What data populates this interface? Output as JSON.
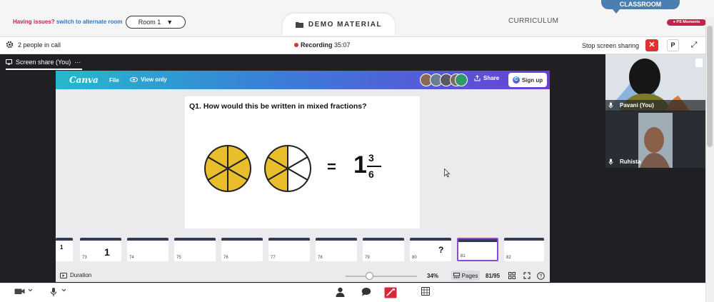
{
  "top": {
    "issues_text": "Having issues?",
    "issues_link": "switch to alternate room",
    "room_label": "Room 1",
    "room_caret": "▼",
    "tab_demo": "DEMO MATERIAL",
    "tab_curriculum": "CURRICULUM",
    "classroom_label": "CLASSROOM",
    "ps_moments": "PS Moments"
  },
  "call": {
    "people": "2 people in call",
    "recording_label": "Recording",
    "recording_time": "35:07",
    "stop_share": "Stop screen sharing",
    "close": "✕",
    "p_button": "P",
    "expand": "⤢"
  },
  "share": {
    "label": "Screen share (You)",
    "more": "···"
  },
  "canva": {
    "logo": "Canva",
    "file": "File",
    "view_only": "View only",
    "share": "Share",
    "sign_up": "Sign up"
  },
  "slide": {
    "question": "Q1. How would this be written in mixed fractions?",
    "equals": "=",
    "whole": "1",
    "numerator": "3",
    "denominator": "6",
    "circle_colors": {
      "fill": "#e8be2c",
      "empty": "#ffffff",
      "stroke": "#222222"
    }
  },
  "thumbs": [
    {
      "page": "",
      "preview": "1"
    },
    {
      "page": "73",
      "preview": "1"
    },
    {
      "page": "74",
      "preview": ""
    },
    {
      "page": "75",
      "preview": ""
    },
    {
      "page": "76",
      "preview": ""
    },
    {
      "page": "77",
      "preview": ""
    },
    {
      "page": "78",
      "preview": ""
    },
    {
      "page": "79",
      "preview": ""
    },
    {
      "page": "80",
      "preview": "?"
    },
    {
      "page": "81",
      "preview": ""
    },
    {
      "page": "82",
      "preview": ""
    }
  ],
  "status": {
    "duration": "Duration",
    "zoom": "34%",
    "pages": "Pages",
    "page_count": "81/95"
  },
  "videos": [
    {
      "name": "Pavani (You)"
    },
    {
      "name": "Ruhista"
    }
  ],
  "colors": {
    "accent_red": "#e03030",
    "brand_pink": "#c0244c",
    "classroom_blue": "#4a7fb0",
    "selected_thumb": "#8a4ad8"
  }
}
